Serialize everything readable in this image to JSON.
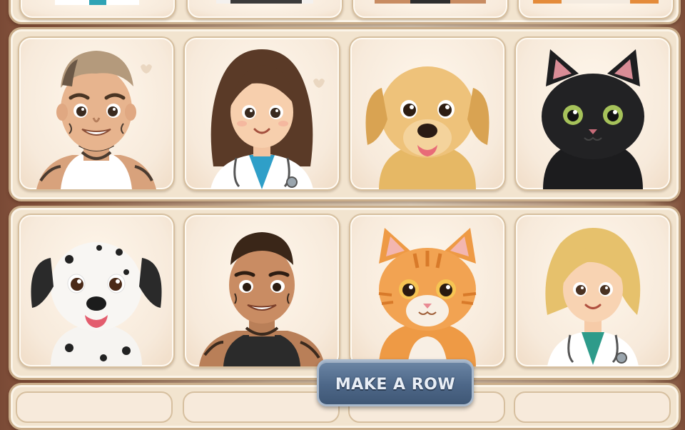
{
  "game": {
    "action_button_label": "MAKE A ROW"
  },
  "rows": [
    {
      "tiles": [
        "partial-tile",
        "partial-tile",
        "partial-tile",
        "partial-tile"
      ]
    },
    {
      "tiles": [
        "tattooed-man",
        "doctor-woman-brunette",
        "golden-retriever-puppy",
        "black-cat"
      ]
    },
    {
      "tiles": [
        "dalmatian-puppy",
        "tattooed-man-dark",
        "orange-tabby-kitten",
        "doctor-woman-blonde"
      ]
    },
    {
      "tiles": [
        "partial-tile",
        "partial-tile",
        "partial-tile",
        "partial-tile"
      ]
    }
  ],
  "colors": {
    "panel": "#f2e4cf",
    "tile": "#f7eadb",
    "button": "#4d6788",
    "button_text": "#e8eef6"
  }
}
